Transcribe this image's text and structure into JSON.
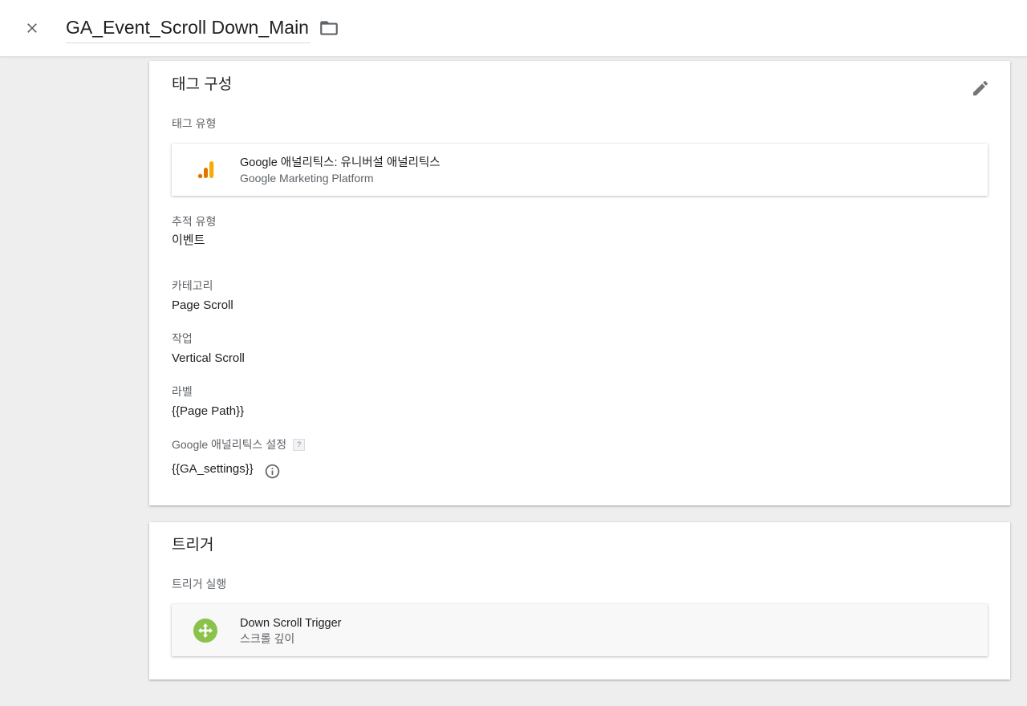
{
  "header": {
    "tag_name": "GA_Event_Scroll Down_Main",
    "close_icon": "close-icon",
    "folder_icon": "folder-icon"
  },
  "tag_config": {
    "title": "태그 구성",
    "edit_icon": "pencil-icon",
    "tag_type_label": "태그 유형",
    "tag_type": {
      "name": "Google 애널리틱스: 유니버설 애널리틱스",
      "provider": "Google Marketing Platform",
      "icon": "google-analytics-icon"
    },
    "fields": {
      "track_type_label": "추적 유형",
      "track_type_value": "이벤트",
      "category_label": "카테고리",
      "category_value": "Page Scroll",
      "action_label": "작업",
      "action_value": "Vertical Scroll",
      "label_label": "라벨",
      "label_value": "{{Page Path}}",
      "ga_settings_label": "Google 애널리틱스 설정",
      "ga_settings_help": "?",
      "ga_settings_value": "{{GA_settings}}"
    }
  },
  "triggering": {
    "title": "트리거",
    "firing_label": "트리거 실행",
    "trigger": {
      "name": "Down Scroll Trigger",
      "type": "스크롤 깊이",
      "icon": "scroll-depth-icon",
      "icon_color": "#8bc34a"
    }
  },
  "colors": {
    "background": "#eeeeee",
    "ga_orange": "#f9ab00",
    "ga_dark_orange": "#e37400"
  }
}
